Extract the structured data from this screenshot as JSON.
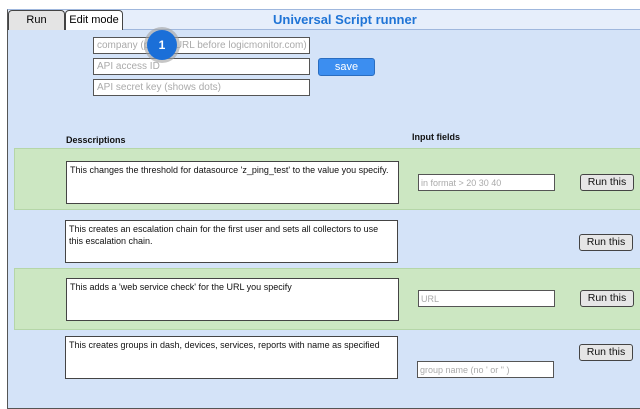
{
  "tabs": [
    {
      "label": "Run",
      "active": false
    },
    {
      "label": "Edit mode",
      "active": true
    }
  ],
  "title": "Universal Script runner",
  "credentials": {
    "company_placeholder": "company (part of URL before logicmonitor.com)",
    "access_id_placeholder": "API access ID",
    "secret_key_placeholder": "API secret key (shows dots)",
    "save_label": "save"
  },
  "marker": "1",
  "headers": {
    "descriptions": "Desscriptions",
    "inputs": "Input fields"
  },
  "scripts": [
    {
      "description": "This changes the threshold for datasource 'z_ping_test' to the value you specify.",
      "input_placeholder": "in format > 20 30 40",
      "button": "Run this"
    },
    {
      "description": "This creates an escalation chain for the first user and sets all collectors to use this escalation chain.",
      "input_placeholder": null,
      "button": "Run this"
    },
    {
      "description": "This adds a 'web service check' for the URL you specify",
      "input_placeholder": "URL",
      "button": "Run this"
    },
    {
      "description": "This creates groups in dash, devices, services, reports with name as specified",
      "input_placeholder": "group name (no ' or \" )",
      "button": "Run this"
    }
  ],
  "colors": {
    "accent": "#1f74d6",
    "save_button": "#3c8ef0",
    "panel": "#d4e3f8",
    "row_highlight": "#cce7c2"
  }
}
